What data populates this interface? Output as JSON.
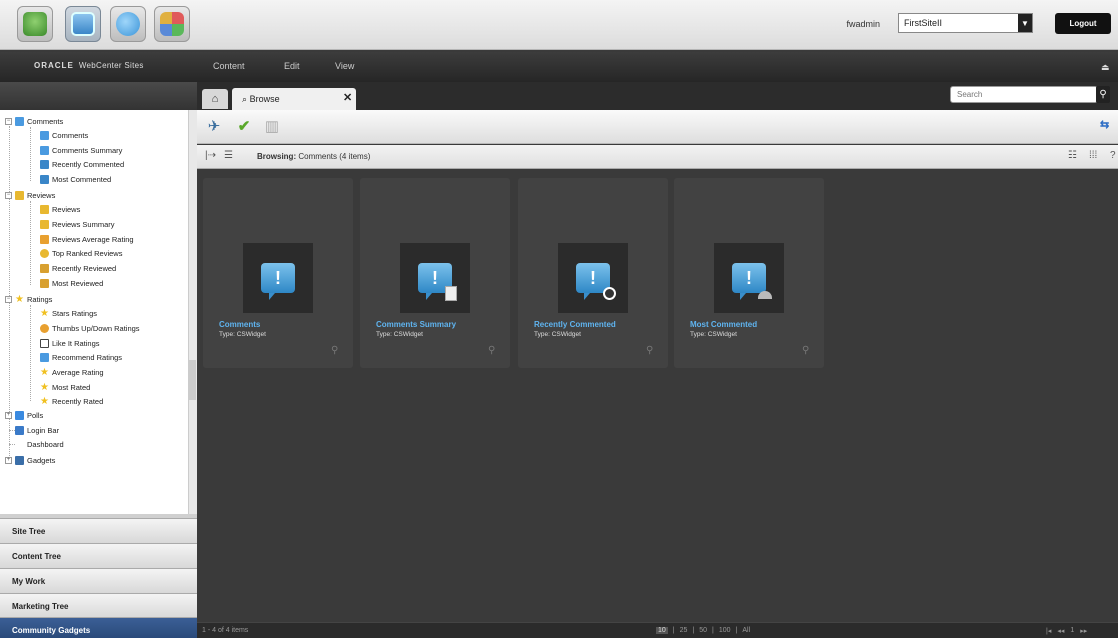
{
  "header": {
    "apps": [
      {
        "name": "Contributor",
        "color": "#4c9a3a"
      },
      {
        "name": "Admin",
        "color": "#5aa0d8"
      },
      {
        "name": "Community",
        "color": "#4aa4e8"
      },
      {
        "name": "Gadgets",
        "color": "#44a060"
      }
    ],
    "user": "fwadmin",
    "site": "FirstSiteII",
    "logout": "Logout"
  },
  "menubar": {
    "logo_brand": "ORACLE",
    "logo_product": "WebCenter Sites",
    "items": [
      "Content",
      "Edit",
      "View"
    ]
  },
  "tabs": {
    "browse_label": "Browse",
    "search_placeholder": "Search"
  },
  "browse": {
    "label": "Browsing:",
    "value": "Comments (4 items)"
  },
  "cards": [
    {
      "title": "Comments",
      "type": "Type: CSWidget",
      "badge": ""
    },
    {
      "title": "Comments Summary",
      "type": "Type: CSWidget",
      "badge": "doc"
    },
    {
      "title": "Recently Commented",
      "type": "Type: CSWidget",
      "badge": "clock"
    },
    {
      "title": "Most Commented",
      "type": "Type: CSWidget",
      "badge": "gauge"
    }
  ],
  "tree": {
    "comments": "Comments",
    "comments_items": [
      "Comments",
      "Comments Summary",
      "Recently Commented",
      "Most Commented"
    ],
    "reviews": "Reviews",
    "reviews_items": [
      "Reviews",
      "Reviews Summary",
      "Reviews Average Rating",
      "Top Ranked Reviews",
      "Recently Reviewed",
      "Most Reviewed"
    ],
    "ratings": "Ratings",
    "ratings_items": [
      "Stars Ratings",
      "Thumbs Up/Down Ratings",
      "Like It Ratings",
      "Recommend Ratings",
      "Average Rating",
      "Most Rated",
      "Recently Rated"
    ],
    "polls": "Polls",
    "login_bar": "Login Bar",
    "dashboard": "Dashboard",
    "gadgets": "Gadgets"
  },
  "accordion": [
    "Site Tree",
    "Content Tree",
    "My Work",
    "Marketing Tree",
    "Community Gadgets"
  ],
  "footer": {
    "count": "1 - 4 of 4 items",
    "page_sizes": [
      "10",
      "25",
      "50",
      "100",
      "All"
    ],
    "page": "1"
  },
  "colors": {
    "accent": "#5fb4f0",
    "active_accordion": "#2a4a7a"
  }
}
